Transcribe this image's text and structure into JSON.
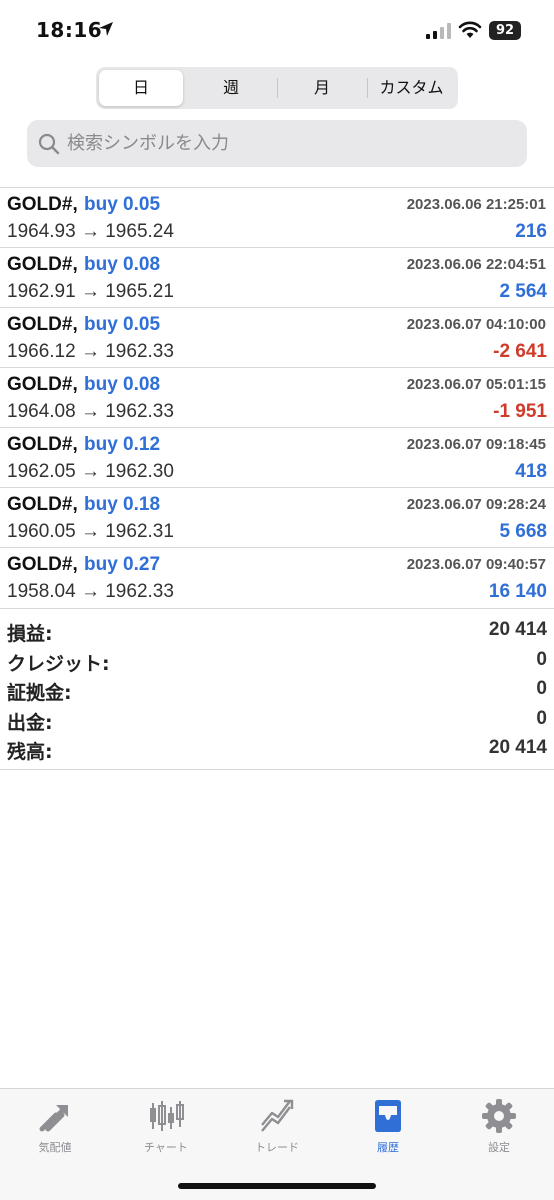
{
  "status": {
    "time": "18:16",
    "battery": "92"
  },
  "period_tabs": [
    {
      "label": "日",
      "active": true
    },
    {
      "label": "週",
      "active": false
    },
    {
      "label": "月",
      "active": false
    },
    {
      "label": "カスタム",
      "active": false
    }
  ],
  "search": {
    "placeholder": "検索シンボルを入力"
  },
  "deals": [
    {
      "symbol": "GOLD#,",
      "type": "buy 0.05",
      "time": "2023.06.06 21:25:01",
      "prices": "1964.93 → 1965.24",
      "profit": "216",
      "profit_sign": "positive"
    },
    {
      "symbol": "GOLD#,",
      "type": "buy 0.08",
      "time": "2023.06.06 22:04:51",
      "prices": "1962.91 → 1965.21",
      "profit": "2 564",
      "profit_sign": "positive"
    },
    {
      "symbol": "GOLD#,",
      "type": "buy 0.05",
      "time": "2023.06.07 04:10:00",
      "prices": "1966.12 → 1962.33",
      "profit": "-2 641",
      "profit_sign": "negative"
    },
    {
      "symbol": "GOLD#,",
      "type": "buy 0.08",
      "time": "2023.06.07 05:01:15",
      "prices": "1964.08 → 1962.33",
      "profit": "-1 951",
      "profit_sign": "negative"
    },
    {
      "symbol": "GOLD#,",
      "type": "buy 0.12",
      "time": "2023.06.07 09:18:45",
      "prices": "1962.05 → 1962.30",
      "profit": "418",
      "profit_sign": "positive"
    },
    {
      "symbol": "GOLD#,",
      "type": "buy 0.18",
      "time": "2023.06.07 09:28:24",
      "prices": "1960.05 → 1962.31",
      "profit": "5 668",
      "profit_sign": "positive"
    },
    {
      "symbol": "GOLD#,",
      "type": "buy 0.27",
      "time": "2023.06.07 09:40:57",
      "prices": "1958.04 → 1962.33",
      "profit": "16 140",
      "profit_sign": "positive"
    }
  ],
  "summary": [
    {
      "label": "損益:",
      "value": "20 414"
    },
    {
      "label": "クレジット:",
      "value": "0"
    },
    {
      "label": "証拠金:",
      "value": "0"
    },
    {
      "label": "出金:",
      "value": "0"
    },
    {
      "label": "残高:",
      "value": "20 414"
    }
  ],
  "tab_bar": [
    {
      "label": "気配値",
      "icon": "quotes-icon",
      "active": false
    },
    {
      "label": "チャート",
      "icon": "candlestick-chart-icon",
      "active": false
    },
    {
      "label": "トレード",
      "icon": "trade-icon",
      "active": false
    },
    {
      "label": "履歴",
      "icon": "history-inbox-icon",
      "active": true
    },
    {
      "label": "設定",
      "icon": "gear-icon",
      "active": false
    }
  ],
  "colors": {
    "accent": "#2f6fd6",
    "loss": "#d03a2a",
    "inactive": "#8e8e93"
  }
}
